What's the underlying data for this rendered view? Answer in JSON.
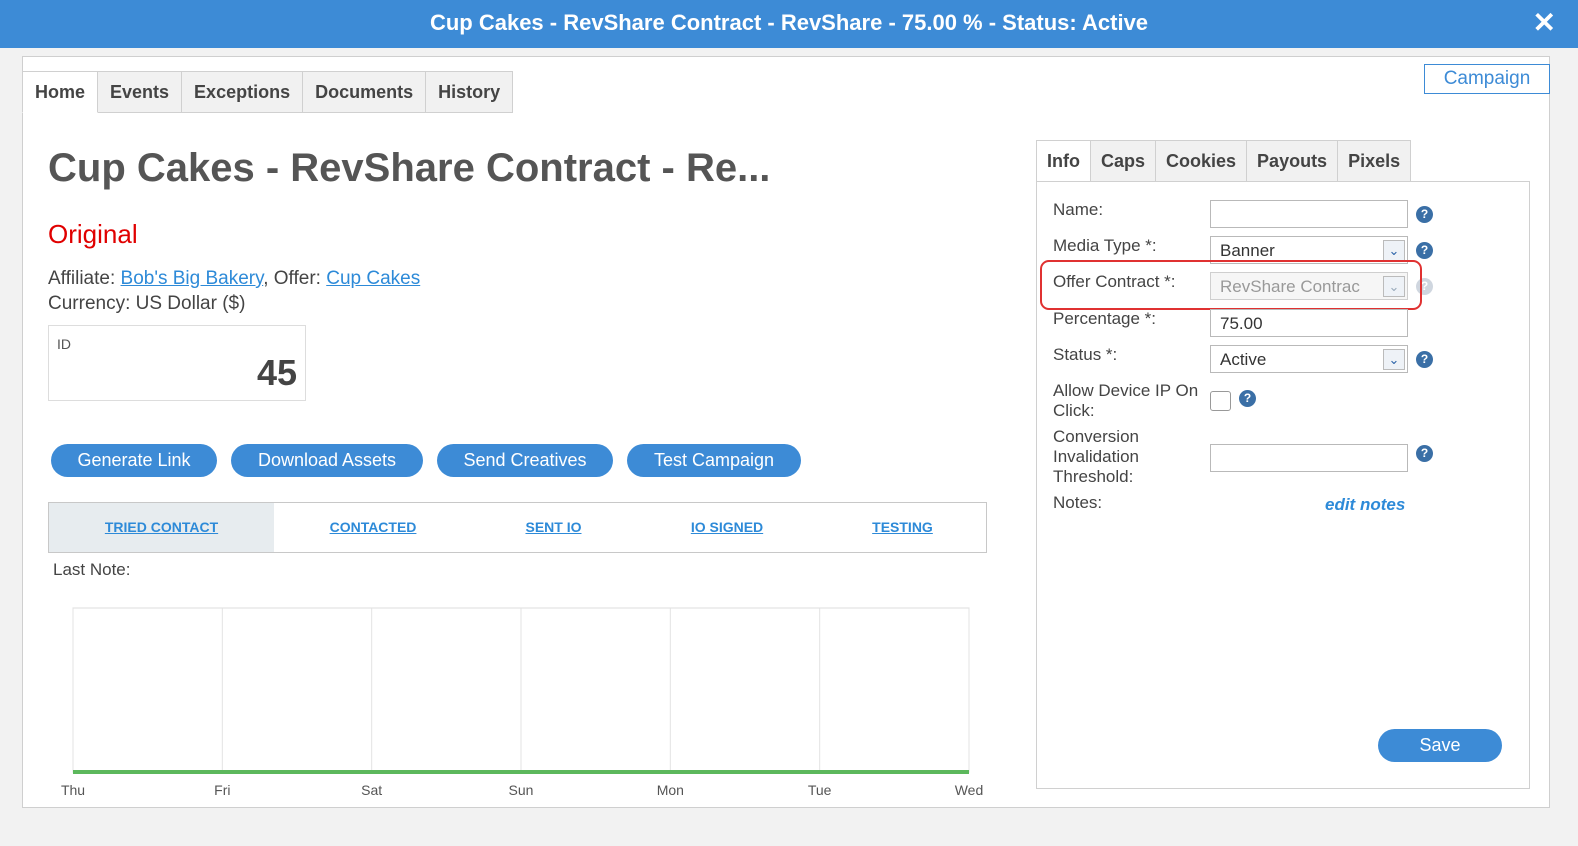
{
  "window": {
    "title": "Cup Cakes - RevShare Contract - RevShare - 75.00 % - Status: Active",
    "close_symbol": "✕"
  },
  "campaign_button": "Campaign",
  "main_tabs": [
    "Home",
    "Events",
    "Exceptions",
    "Documents",
    "History"
  ],
  "header": {
    "title": "Cup Cakes - RevShare Contract - Re...",
    "status": "Original",
    "affiliate_label": "Affiliate:",
    "affiliate_name": "Bob's Big Bakery",
    "offer_label": "Offer:",
    "offer_name": "Cup Cakes",
    "currency": "Currency: US Dollar ($)"
  },
  "id_box": {
    "label": "ID",
    "value": "45"
  },
  "actions": [
    "Generate Link",
    "Download Assets",
    "Send Creatives",
    "Test Campaign"
  ],
  "stages": [
    "TRIED CONTACT",
    "CONTACTED",
    "SENT IO",
    "IO SIGNED",
    "TESTING"
  ],
  "last_note_label": "Last Note:",
  "chart_data": {
    "type": "line",
    "categories": [
      "Thu",
      "Fri",
      "Sat",
      "Sun",
      "Mon",
      "Tue",
      "Wed"
    ],
    "series": [
      {
        "values": [
          0,
          0,
          0,
          0,
          0,
          0,
          0
        ],
        "color": "#5cb85c"
      }
    ],
    "grid": true
  },
  "side_tabs": [
    "Info",
    "Caps",
    "Cookies",
    "Payouts",
    "Pixels"
  ],
  "form": {
    "name_label": "Name:",
    "name_value": "",
    "media_type_label": "Media Type *:",
    "media_type_value": "Banner",
    "offer_contract_label": "Offer Contract *:",
    "offer_contract_value": "RevShare Contrac",
    "percentage_label": "Percentage *:",
    "percentage_value": "75.00",
    "status_label": "Status *:",
    "status_value": "Active",
    "allow_ip_label_1": "Allow Device IP On",
    "allow_ip_label_2": "Click:",
    "threshold_label_1": "Conversion",
    "threshold_label_2": "Invalidation",
    "threshold_label_3": "Threshold:",
    "threshold_value": "",
    "notes_label": "Notes:",
    "edit_notes": "edit notes",
    "help_symbol": "?",
    "dropdown_symbol": "⌄"
  },
  "save_button": "Save",
  "colors": {
    "accent": "#3d8bd6",
    "status_red": "#e00000",
    "highlight": "#e03131",
    "chart_line": "#5cb85c"
  }
}
